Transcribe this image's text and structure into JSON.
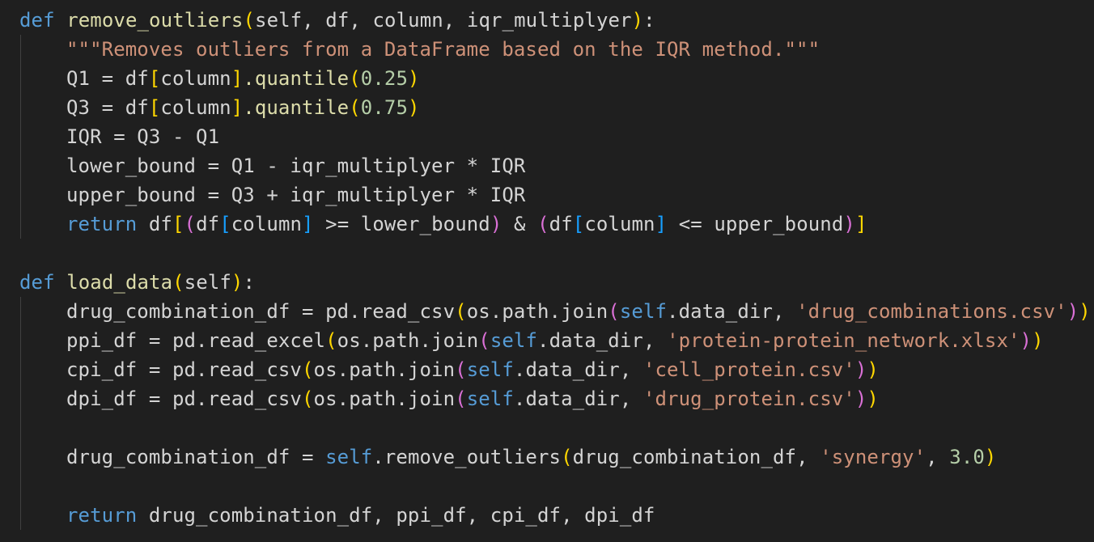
{
  "code_lines": [
    [
      {
        "text": "def",
        "type": "kw"
      },
      {
        "text": " remove_outliers",
        "type": "fn"
      },
      {
        "text": "(",
        "type": "b1"
      },
      {
        "text": "self, df, column, iqr_multiplyer",
        "type": "default"
      },
      {
        "text": ")",
        "type": "b1"
      },
      {
        "text": ":",
        "type": "default"
      }
    ],
    [
      {
        "text": "\"\"\"Removes outliers from a DataFrame based on the IQR method.\"\"\"",
        "type": "str"
      }
    ],
    [
      {
        "text": "Q1 = df",
        "type": "default"
      },
      {
        "text": "[",
        "type": "b1"
      },
      {
        "text": "column",
        "type": "default"
      },
      {
        "text": "]",
        "type": "b1"
      },
      {
        "text": ".quantile",
        "type": "fn"
      },
      {
        "text": "(",
        "type": "b1"
      },
      {
        "text": "0.25",
        "type": "num"
      },
      {
        "text": ")",
        "type": "b1"
      }
    ],
    [
      {
        "text": "Q3 = df",
        "type": "default"
      },
      {
        "text": "[",
        "type": "b1"
      },
      {
        "text": "column",
        "type": "default"
      },
      {
        "text": "]",
        "type": "b1"
      },
      {
        "text": ".quantile",
        "type": "fn"
      },
      {
        "text": "(",
        "type": "b1"
      },
      {
        "text": "0.75",
        "type": "num"
      },
      {
        "text": ")",
        "type": "b1"
      }
    ],
    [
      {
        "text": "IQR = Q3 - Q1",
        "type": "default"
      }
    ],
    [
      {
        "text": "lower_bound = Q1 - iqr_multiplyer * IQR",
        "type": "default"
      }
    ],
    [
      {
        "text": "upper_bound = Q3 + iqr_multiplyer * IQR",
        "type": "default"
      }
    ],
    [
      {
        "text": "return",
        "type": "kw"
      },
      {
        "text": " df",
        "type": "default"
      },
      {
        "text": "[",
        "type": "b1"
      },
      {
        "text": "(",
        "type": "b2"
      },
      {
        "text": "df",
        "type": "default"
      },
      {
        "text": "[",
        "type": "b3"
      },
      {
        "text": "column",
        "type": "default"
      },
      {
        "text": "]",
        "type": "b3"
      },
      {
        "text": " >= lower_bound",
        "type": "default"
      },
      {
        "text": ")",
        "type": "b2"
      },
      {
        "text": " & ",
        "type": "default"
      },
      {
        "text": "(",
        "type": "b2"
      },
      {
        "text": "df",
        "type": "default"
      },
      {
        "text": "[",
        "type": "b3"
      },
      {
        "text": "column",
        "type": "default"
      },
      {
        "text": "]",
        "type": "b3"
      },
      {
        "text": " <= upper_bound",
        "type": "default"
      },
      {
        "text": ")",
        "type": "b2"
      },
      {
        "text": "]",
        "type": "b1"
      }
    ],
    [],
    [
      {
        "text": "def",
        "type": "kw"
      },
      {
        "text": " load_data",
        "type": "fn"
      },
      {
        "text": "(",
        "type": "b1"
      },
      {
        "text": "self",
        "type": "default"
      },
      {
        "text": ")",
        "type": "b1"
      },
      {
        "text": ":",
        "type": "default"
      }
    ],
    [
      {
        "text": "drug_combination_df = pd.read_csv",
        "type": "default"
      },
      {
        "text": "(",
        "type": "b1"
      },
      {
        "text": "os.path.join",
        "type": "default"
      },
      {
        "text": "(",
        "type": "b2"
      },
      {
        "text": "self",
        "type": "kw"
      },
      {
        "text": ".data_dir, ",
        "type": "default"
      },
      {
        "text": "'drug_combinations.csv'",
        "type": "str"
      },
      {
        "text": ")",
        "type": "b2"
      },
      {
        "text": ")",
        "type": "b1"
      }
    ],
    [
      {
        "text": "ppi_df = pd.read_excel",
        "type": "default"
      },
      {
        "text": "(",
        "type": "b1"
      },
      {
        "text": "os.path.join",
        "type": "default"
      },
      {
        "text": "(",
        "type": "b2"
      },
      {
        "text": "self",
        "type": "kw"
      },
      {
        "text": ".data_dir, ",
        "type": "default"
      },
      {
        "text": "'protein-protein_network.xlsx'",
        "type": "str"
      },
      {
        "text": ")",
        "type": "b2"
      },
      {
        "text": ")",
        "type": "b1"
      }
    ],
    [
      {
        "text": "cpi_df = pd.read_csv",
        "type": "default"
      },
      {
        "text": "(",
        "type": "b1"
      },
      {
        "text": "os.path.join",
        "type": "default"
      },
      {
        "text": "(",
        "type": "b2"
      },
      {
        "text": "self",
        "type": "kw"
      },
      {
        "text": ".data_dir, ",
        "type": "default"
      },
      {
        "text": "'cell_protein.csv'",
        "type": "str"
      },
      {
        "text": ")",
        "type": "b2"
      },
      {
        "text": ")",
        "type": "b1"
      }
    ],
    [
      {
        "text": "dpi_df = pd.read_csv",
        "type": "default"
      },
      {
        "text": "(",
        "type": "b1"
      },
      {
        "text": "os.path.join",
        "type": "default"
      },
      {
        "text": "(",
        "type": "b2"
      },
      {
        "text": "self",
        "type": "kw"
      },
      {
        "text": ".data_dir, ",
        "type": "default"
      },
      {
        "text": "'drug_protein.csv'",
        "type": "str"
      },
      {
        "text": ")",
        "type": "b2"
      },
      {
        "text": ")",
        "type": "b1"
      }
    ],
    [],
    [
      {
        "text": "drug_combination_df = ",
        "type": "default"
      },
      {
        "text": "self",
        "type": "kw"
      },
      {
        "text": ".remove_outliers",
        "type": "default"
      },
      {
        "text": "(",
        "type": "b1"
      },
      {
        "text": "drug_combination_df, ",
        "type": "default"
      },
      {
        "text": "'synergy'",
        "type": "str"
      },
      {
        "text": ", ",
        "type": "default"
      },
      {
        "text": "3.0",
        "type": "num"
      },
      {
        "text": ")",
        "type": "b1"
      }
    ],
    [],
    [
      {
        "text": "return",
        "type": "kw"
      },
      {
        "text": " drug_combination_df, ppi_df, cpi_df, dpi_df",
        "type": "default"
      }
    ]
  ]
}
